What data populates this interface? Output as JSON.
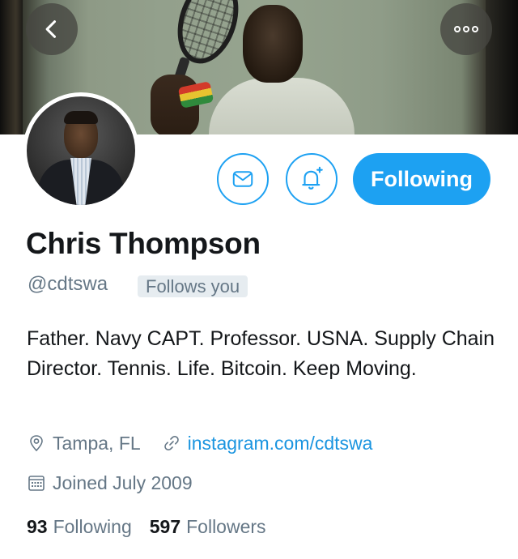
{
  "profile": {
    "name": "Chris Thompson",
    "handle": "@cdtswa",
    "follows_you_label": "Follows you",
    "bio": "Father. Navy CAPT. Professor. USNA. Supply Chain Director. Tennis. Life. Bitcoin. Keep Moving.",
    "location": "Tampa, FL",
    "website": "instagram.com/cdtswa",
    "joined": "Joined July 2009",
    "following_count": "93",
    "following_label": "Following",
    "followers_count": "597",
    "followers_label": "Followers"
  },
  "actions": {
    "following_button_label": "Following"
  },
  "icons": {
    "back": "chevron-left-icon",
    "more": "more-horizontal-icon",
    "message": "envelope-icon",
    "notify": "bell-plus-icon",
    "location": "location-pin-icon",
    "link": "link-icon",
    "calendar": "calendar-icon"
  },
  "colors": {
    "accent": "#1da1f2",
    "link": "#1b95e0",
    "text": "#14171a",
    "secondary_text": "#657786",
    "badge_bg": "#e6ecf0"
  }
}
